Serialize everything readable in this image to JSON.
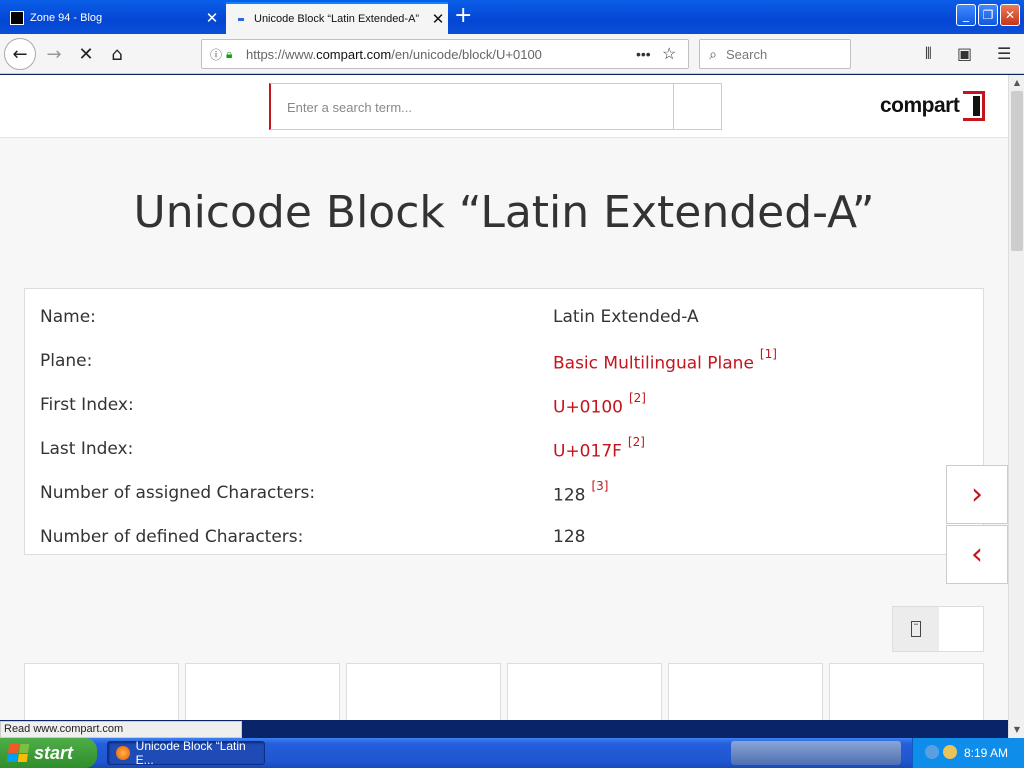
{
  "browser": {
    "tabs": [
      {
        "label": "Zone 94 - Blog",
        "active": false
      },
      {
        "label": "Unicode Block “Latin Extended-A”",
        "active": true
      }
    ],
    "new_tab": "+",
    "url_prefix": "https://www.",
    "url_domain": "compart.com",
    "url_path": "/en/unicode/block/U+0100",
    "search_placeholder": "Search",
    "status_text": "Read www.compart.com"
  },
  "site": {
    "search_placeholder": "Enter a search term...",
    "logo_text": "compart",
    "accent_color": "#c4141e"
  },
  "page_title": "Unicode Block “Latin Extended-A”",
  "info": [
    {
      "key": "Name:",
      "value": "Latin Extended-A",
      "link": false,
      "ref": ""
    },
    {
      "key": "Plane:",
      "value": "Basic Multilingual Plane",
      "link": true,
      "ref": "[1]"
    },
    {
      "key": "First Index:",
      "value": "U+0100",
      "link": true,
      "ref": "[2]"
    },
    {
      "key": "Last Index:",
      "value": "U+017F",
      "link": true,
      "ref": "[2]"
    },
    {
      "key": "Number of assigned Characters:",
      "value": "128",
      "link": false,
      "ref": "[3]"
    },
    {
      "key": "Number of defined Characters:",
      "value": "128",
      "link": false,
      "ref": ""
    }
  ],
  "nav": {
    "next": "›",
    "prev": "‹"
  },
  "taskbar": {
    "start_label": "start",
    "task_label": "Unicode Block “Latin E...",
    "clock": "8:19 AM"
  }
}
